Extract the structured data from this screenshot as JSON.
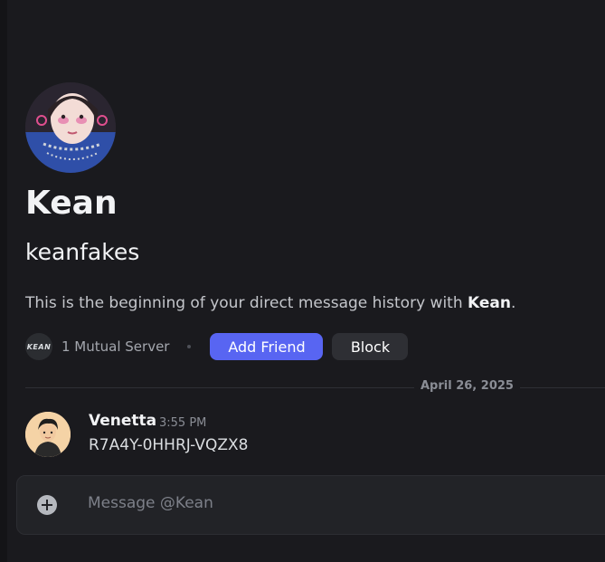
{
  "profile": {
    "display_name": "Kean",
    "username": "keanfakes",
    "intro_prefix": "This is the beginning of your direct message history with ",
    "intro_name": "Kean",
    "intro_suffix": ".",
    "mutual_server_label": "1 Mutual Server",
    "server_icon_text": "KEAN",
    "add_friend_label": "Add Friend",
    "block_label": "Block"
  },
  "divider": {
    "date": "April 26, 2025"
  },
  "messages": [
    {
      "author": "Venetta",
      "time": "3:55 PM",
      "content": "R7A4Y-0HHRJ-VQZX8"
    }
  ],
  "composer": {
    "placeholder": "Message @Kean"
  },
  "colors": {
    "background": "#1a1a1e",
    "accent": "#5865f2",
    "secondary_button": "#2e2f34",
    "text_primary": "#f2f3f5",
    "text_muted": "#8a8d95"
  },
  "icons": {
    "add": "plus-circle-icon"
  }
}
